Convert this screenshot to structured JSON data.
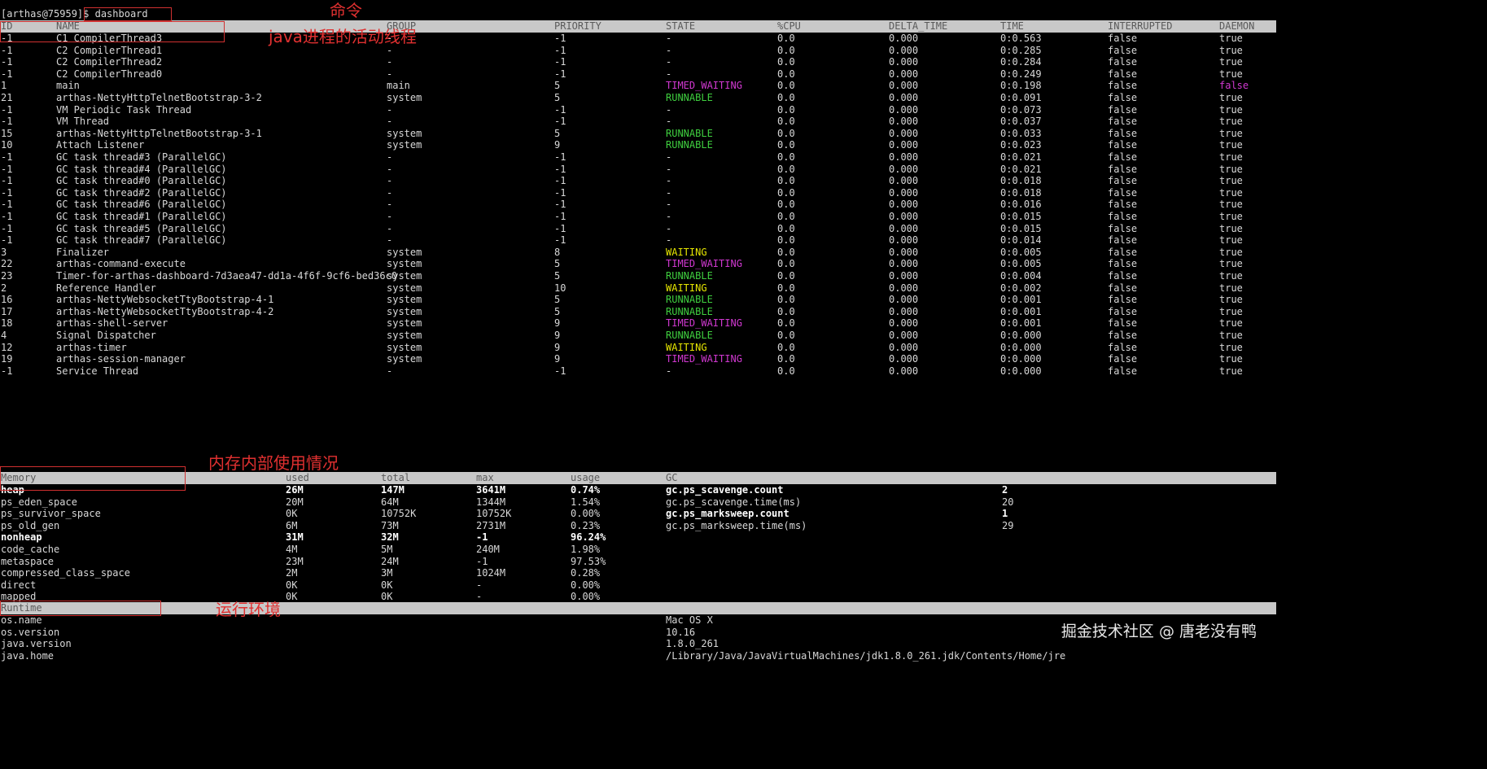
{
  "prompt": {
    "text": "[arthas@75959]$ dashboard"
  },
  "annotations": {
    "command": "命令",
    "threads": "java进程的活动线程",
    "memory": "内存内部使用情况",
    "runtime": "运行环境"
  },
  "watermark": "掘金技术社区 @ 唐老没有鸭",
  "threads": {
    "headers": [
      "ID",
      "NAME",
      "GROUP",
      "PRIORITY",
      "STATE",
      "%CPU",
      "DELTA_TIME",
      "TIME",
      "INTERRUPTED",
      "DAEMON"
    ],
    "rows": [
      [
        "-1",
        "C1 CompilerThread3",
        "-",
        "-1",
        "-",
        "0.0",
        "0.000",
        "0:0.563",
        "false",
        "true"
      ],
      [
        "-1",
        "C2 CompilerThread1",
        "-",
        "-1",
        "-",
        "0.0",
        "0.000",
        "0:0.285",
        "false",
        "true"
      ],
      [
        "-1",
        "C2 CompilerThread2",
        "-",
        "-1",
        "-",
        "0.0",
        "0.000",
        "0:0.284",
        "false",
        "true"
      ],
      [
        "-1",
        "C2 CompilerThread0",
        "-",
        "-1",
        "-",
        "0.0",
        "0.000",
        "0:0.249",
        "false",
        "true"
      ],
      [
        "1",
        "main",
        "main",
        "5",
        "TIMED_WAITING",
        "0.0",
        "0.000",
        "0:0.198",
        "false",
        "false"
      ],
      [
        "21",
        "arthas-NettyHttpTelnetBootstrap-3-2",
        "system",
        "5",
        "RUNNABLE",
        "0.0",
        "0.000",
        "0:0.091",
        "false",
        "true"
      ],
      [
        "-1",
        "VM Periodic Task Thread",
        "-",
        "-1",
        "-",
        "0.0",
        "0.000",
        "0:0.073",
        "false",
        "true"
      ],
      [
        "-1",
        "VM Thread",
        "-",
        "-1",
        "-",
        "0.0",
        "0.000",
        "0:0.037",
        "false",
        "true"
      ],
      [
        "15",
        "arthas-NettyHttpTelnetBootstrap-3-1",
        "system",
        "5",
        "RUNNABLE",
        "0.0",
        "0.000",
        "0:0.033",
        "false",
        "true"
      ],
      [
        "10",
        "Attach Listener",
        "system",
        "9",
        "RUNNABLE",
        "0.0",
        "0.000",
        "0:0.023",
        "false",
        "true"
      ],
      [
        "-1",
        "GC task thread#3 (ParallelGC)",
        "-",
        "-1",
        "-",
        "0.0",
        "0.000",
        "0:0.021",
        "false",
        "true"
      ],
      [
        "-1",
        "GC task thread#4 (ParallelGC)",
        "-",
        "-1",
        "-",
        "0.0",
        "0.000",
        "0:0.021",
        "false",
        "true"
      ],
      [
        "-1",
        "GC task thread#0 (ParallelGC)",
        "-",
        "-1",
        "-",
        "0.0",
        "0.000",
        "0:0.018",
        "false",
        "true"
      ],
      [
        "-1",
        "GC task thread#2 (ParallelGC)",
        "-",
        "-1",
        "-",
        "0.0",
        "0.000",
        "0:0.018",
        "false",
        "true"
      ],
      [
        "-1",
        "GC task thread#6 (ParallelGC)",
        "-",
        "-1",
        "-",
        "0.0",
        "0.000",
        "0:0.016",
        "false",
        "true"
      ],
      [
        "-1",
        "GC task thread#1 (ParallelGC)",
        "-",
        "-1",
        "-",
        "0.0",
        "0.000",
        "0:0.015",
        "false",
        "true"
      ],
      [
        "-1",
        "GC task thread#5 (ParallelGC)",
        "-",
        "-1",
        "-",
        "0.0",
        "0.000",
        "0:0.015",
        "false",
        "true"
      ],
      [
        "-1",
        "GC task thread#7 (ParallelGC)",
        "-",
        "-1",
        "-",
        "0.0",
        "0.000",
        "0:0.014",
        "false",
        "true"
      ],
      [
        "3",
        "Finalizer",
        "system",
        "8",
        "WAITING",
        "0.0",
        "0.000",
        "0:0.005",
        "false",
        "true"
      ],
      [
        "22",
        "arthas-command-execute",
        "system",
        "5",
        "TIMED_WAITING",
        "0.0",
        "0.000",
        "0:0.005",
        "false",
        "true"
      ],
      [
        "23",
        "Timer-for-arthas-dashboard-7d3aea47-dd1a-4f6f-9cf6-bed36c0",
        "system",
        "5",
        "RUNNABLE",
        "0.0",
        "0.000",
        "0:0.004",
        "false",
        "true"
      ],
      [
        "2",
        "Reference Handler",
        "system",
        "10",
        "WAITING",
        "0.0",
        "0.000",
        "0:0.002",
        "false",
        "true"
      ],
      [
        "16",
        "arthas-NettyWebsocketTtyBootstrap-4-1",
        "system",
        "5",
        "RUNNABLE",
        "0.0",
        "0.000",
        "0:0.001",
        "false",
        "true"
      ],
      [
        "17",
        "arthas-NettyWebsocketTtyBootstrap-4-2",
        "system",
        "5",
        "RUNNABLE",
        "0.0",
        "0.000",
        "0:0.001",
        "false",
        "true"
      ],
      [
        "18",
        "arthas-shell-server",
        "system",
        "9",
        "TIMED_WAITING",
        "0.0",
        "0.000",
        "0:0.001",
        "false",
        "true"
      ],
      [
        "4",
        "Signal Dispatcher",
        "system",
        "9",
        "RUNNABLE",
        "0.0",
        "0.000",
        "0:0.000",
        "false",
        "true"
      ],
      [
        "12",
        "arthas-timer",
        "system",
        "9",
        "WAITING",
        "0.0",
        "0.000",
        "0:0.000",
        "false",
        "true"
      ],
      [
        "19",
        "arthas-session-manager",
        "system",
        "9",
        "TIMED_WAITING",
        "0.0",
        "0.000",
        "0:0.000",
        "false",
        "true"
      ],
      [
        "-1",
        "Service Thread",
        "-",
        "-1",
        "-",
        "0.0",
        "0.000",
        "0:0.000",
        "false",
        "true"
      ]
    ]
  },
  "memory": {
    "headers": [
      "Memory",
      "used",
      "total",
      "max",
      "usage",
      "GC"
    ],
    "rows": [
      {
        "name": "heap",
        "used": "26M",
        "total": "147M",
        "max": "3641M",
        "usage": "0.74%",
        "bold": true
      },
      {
        "name": "ps_eden_space",
        "used": "20M",
        "total": "64M",
        "max": "1344M",
        "usage": "1.54%",
        "bold": false
      },
      {
        "name": "ps_survivor_space",
        "used": "0K",
        "total": "10752K",
        "max": "10752K",
        "usage": "0.00%",
        "bold": false
      },
      {
        "name": "ps_old_gen",
        "used": "6M",
        "total": "73M",
        "max": "2731M",
        "usage": "0.23%",
        "bold": false
      },
      {
        "name": "nonheap",
        "used": "31M",
        "total": "32M",
        "max": "-1",
        "usage": "96.24%",
        "bold": true
      },
      {
        "name": "code_cache",
        "used": "4M",
        "total": "5M",
        "max": "240M",
        "usage": "1.98%",
        "bold": false
      },
      {
        "name": "metaspace",
        "used": "23M",
        "total": "24M",
        "max": "-1",
        "usage": "97.53%",
        "bold": false
      },
      {
        "name": "compressed_class_space",
        "used": "2M",
        "total": "3M",
        "max": "1024M",
        "usage": "0.28%",
        "bold": false
      },
      {
        "name": "direct",
        "used": "0K",
        "total": "0K",
        "max": "-",
        "usage": "0.00%",
        "bold": false
      },
      {
        "name": "mapped",
        "used": "0K",
        "total": "0K",
        "max": "-",
        "usage": "0.00%",
        "bold": false
      }
    ],
    "gc": [
      {
        "name": "gc.ps_scavenge.count",
        "value": "2",
        "bold": true
      },
      {
        "name": "gc.ps_scavenge.time(ms)",
        "value": "20",
        "bold": false
      },
      {
        "name": "gc.ps_marksweep.count",
        "value": "1",
        "bold": true
      },
      {
        "name": "gc.ps_marksweep.time(ms)",
        "value": "29",
        "bold": false
      }
    ]
  },
  "runtime": {
    "header": "Runtime",
    "rows": [
      {
        "key": "os.name",
        "value": "Mac OS X"
      },
      {
        "key": "os.version",
        "value": "10.16"
      },
      {
        "key": "java.version",
        "value": "1.8.0_261"
      },
      {
        "key": "java.home",
        "value": "/Library/Java/JavaVirtualMachines/jdk1.8.0_261.jdk/Contents/Home/jre"
      }
    ]
  },
  "colors": {
    "runnable": "#3fce3f",
    "timed_waiting": "#d038d0",
    "waiting": "#e6e600",
    "header_bg": "#c8c8c8",
    "annotation": "#e03030"
  }
}
